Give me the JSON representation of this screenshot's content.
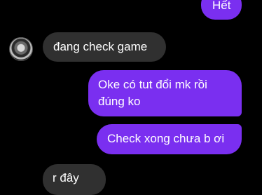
{
  "messages": [
    {
      "sender": "self",
      "text": "Hết"
    },
    {
      "sender": "other",
      "text": "đang check game"
    },
    {
      "sender": "self",
      "text": "Oke có tut đổi mk rồi đúng ko"
    },
    {
      "sender": "self",
      "text": "Check xong chưa b ơi"
    },
    {
      "sender": "other",
      "text": "r đây"
    }
  ],
  "colors": {
    "background": "#000000",
    "outgoing_bubble": "#7a2ff0",
    "incoming_bubble": "#303030",
    "text": "#ffffff"
  }
}
